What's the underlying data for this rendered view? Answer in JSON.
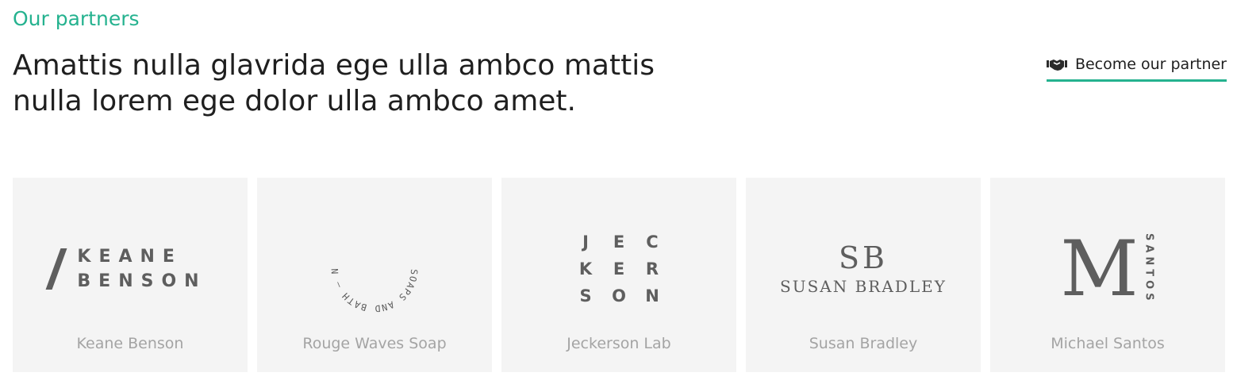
{
  "section": {
    "eyebrow": "Our partners",
    "headline": "Amattis nulla glavrida ege ulla ambco mattis nulla lorem ege dolor ulla ambco amet.",
    "cta": {
      "label": "Become our partner",
      "icon": "handshake-icon"
    }
  },
  "partners": [
    {
      "name": "Keane Benson",
      "logo": {
        "line1": "KEANE",
        "line2": "BENSON"
      }
    },
    {
      "name": "Rouge Waves Soap",
      "logo": {
        "ring_text": "SOAPS AND BATH – NEW YORK – ROGUE WAVES"
      }
    },
    {
      "name": "Jeckerson Lab",
      "logo": {
        "letters": [
          "J",
          "E",
          "C",
          "K",
          "E",
          "R",
          "S",
          "O",
          "N"
        ]
      }
    },
    {
      "name": "Susan Bradley",
      "logo": {
        "monogram": "SB",
        "full": "SUSAN BRADLEY"
      }
    },
    {
      "name": "Michael Santos",
      "logo": {
        "initial": "M",
        "side": "SANTOS"
      }
    }
  ],
  "colors": {
    "accent": "#25b28f",
    "card_bg": "#f4f4f4",
    "logo": "#5e5e5e",
    "caption": "#a4a4a4"
  }
}
